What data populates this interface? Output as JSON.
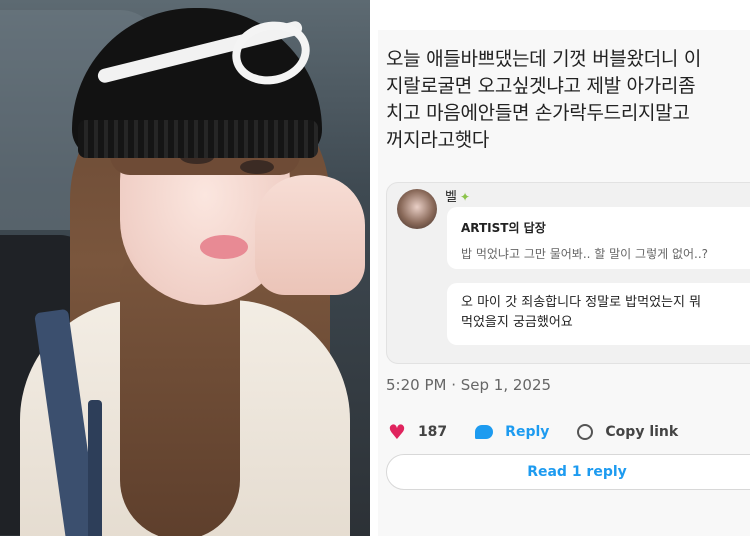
{
  "post": {
    "text": "오늘 애들바쁘댔는데 기껏 버블왔더니 이\n지랄로굴면 오고싶겟냐고 제발 아가리좀\n치고 마음에안들면 손가락두드리지말고\n꺼지라고햇다"
  },
  "reply_card": {
    "username": "벨",
    "username_icon": "butterfly-icon",
    "artist_label": "ARTIST의 답장",
    "artist_reply": "밥 먹었냐고 그만 물어봐.. 할 말이 그렇게 없어..?",
    "user_reply": "오 마이 갓 죄송합니다 정말로 밥먹었는지 뭐\n먹었을지 궁금했어요"
  },
  "meta": {
    "timestamp": "5:20 PM · Sep 1, 2025"
  },
  "actions": {
    "like_count": "187",
    "reply_label": "Reply",
    "copy_link_label": "Copy link",
    "read_reply_label": "Read 1 reply"
  },
  "colors": {
    "accent": "#1d9bf0",
    "like": "#e0245e"
  }
}
